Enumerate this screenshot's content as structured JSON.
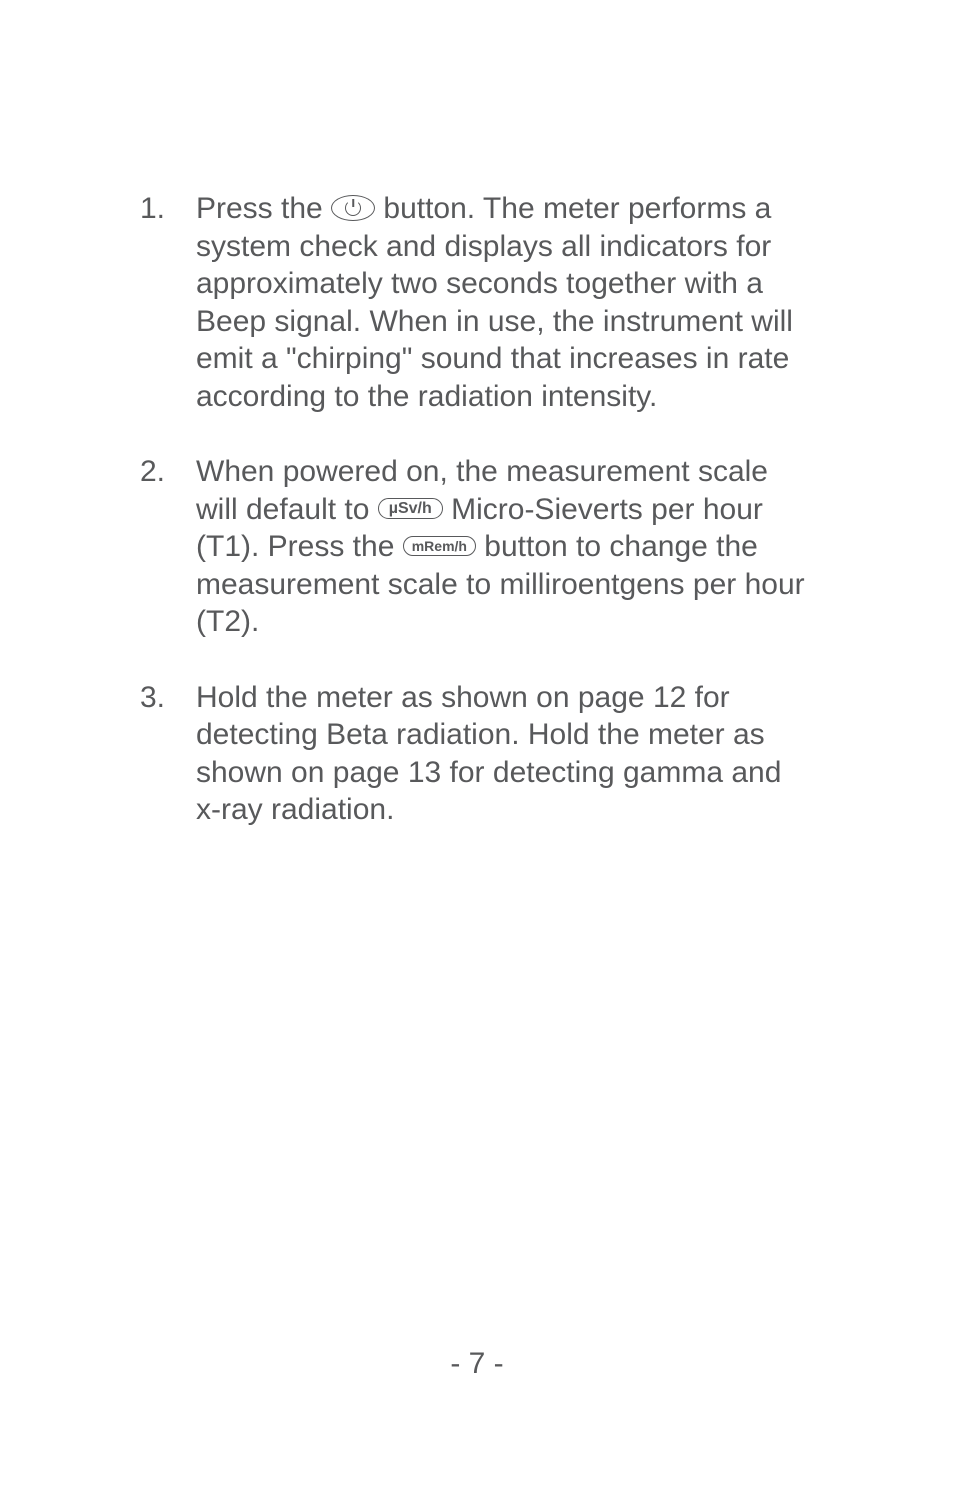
{
  "items": [
    {
      "number": "1.",
      "pre": "Press the ",
      "icon": "power",
      "post": " button. The meter performs a system check and displays all indicators for approximately two seconds together with a Beep signal. When in use, the instrument will emit a \"chirping\" sound that increases in rate according to the radiation intensity."
    },
    {
      "number": "2.",
      "line1_pre": "When powered on, the measurement scale will default to ",
      "usv_label": "µSv/h",
      "line1_mid": " Micro-Sieverts per hour (T1). Press the ",
      "mrem_label": "mRem/h",
      "line1_post": " button to change the measurement scale to milliroentgens per hour (T2)."
    },
    {
      "number": "3.",
      "text": "Hold the meter as shown on page 12 for detecting Beta radiation. Hold the meter as shown on page 13 for detecting gamma and x-ray radiation."
    }
  ],
  "page_number": "- 7 -"
}
